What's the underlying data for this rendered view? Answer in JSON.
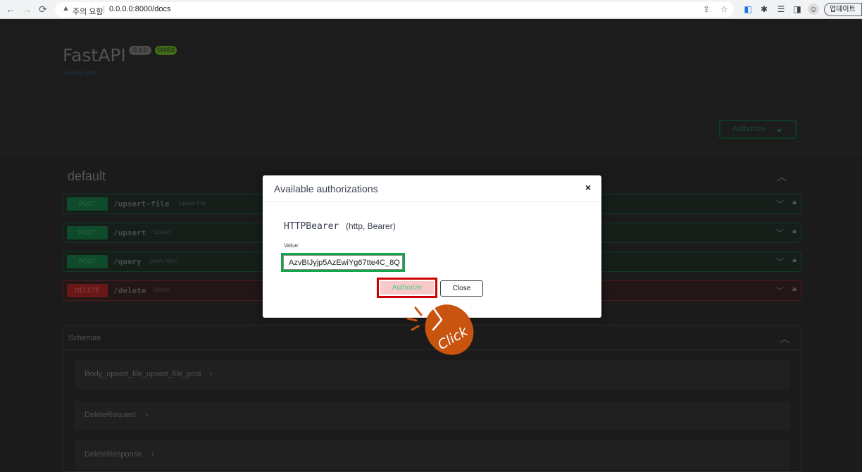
{
  "browser": {
    "warning_text": "주의 요함",
    "url": "0.0.0.0:8000/docs",
    "update_label": "업데이트"
  },
  "swagger": {
    "title": "FastAPI",
    "version_badge": "0.1.0",
    "oas_badge": "OAS3",
    "openapi_link": "/openapi.json",
    "authorize_label": "Authorize",
    "section_title": "default",
    "operations": [
      {
        "method": "POST",
        "path": "/upsert-file",
        "summary": "Upsert File"
      },
      {
        "method": "POST",
        "path": "/upsert",
        "summary": "Upsert"
      },
      {
        "method": "POST",
        "path": "/query",
        "summary": "Query Main"
      },
      {
        "method": "DELETE",
        "path": "/delete",
        "summary": "Delete"
      }
    ],
    "schemas_title": "Schemas",
    "schemas": [
      "Body_upsert_file_upsert_file_post",
      "DeleteRequest",
      "DeleteResponse"
    ]
  },
  "modal": {
    "title": "Available authorizations",
    "close_symbol": "×",
    "scheme_name": "HTTPBearer",
    "scheme_type": "(http, Bearer)",
    "value_label": "Value:",
    "token_value": "AzvBIJyjp5AzEwiYg67tte4C_8Q",
    "authorize_label": "Authorize",
    "close_label": "Close"
  },
  "annotation": {
    "text": "Click"
  },
  "colors": {
    "post_green": "#49cc90",
    "delete_red": "#f93e3e",
    "highlight_green": "#11a84a",
    "highlight_red": "#cc0000",
    "click_orange": "#c85410"
  }
}
